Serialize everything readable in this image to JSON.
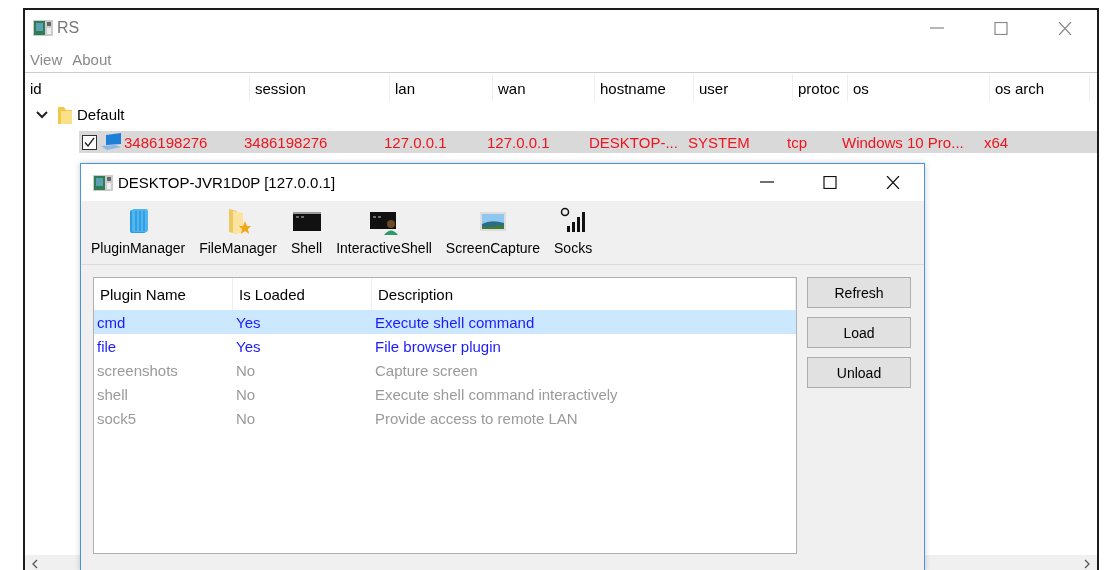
{
  "window": {
    "title": "RS"
  },
  "menu": [
    {
      "label": "View"
    },
    {
      "label": "About"
    }
  ],
  "table": {
    "columns": [
      "id",
      "session",
      "lan",
      "wan",
      "hostname",
      "user",
      "protoc",
      "os",
      "os arch"
    ],
    "groups": [
      {
        "name": "Default",
        "expanded": true,
        "rows": [
          {
            "checked": true,
            "selected": true,
            "cells": [
              "3486198276",
              "3486198276",
              "127.0.0.1",
              "127.0.0.1",
              "DESKTOP-...",
              "SYSTEM",
              "tcp",
              "Windows 10 Pro...",
              "x64"
            ]
          }
        ]
      }
    ]
  },
  "dialog": {
    "title": "DESKTOP-JVR1D0P [127.0.0.1]",
    "toolbar": [
      {
        "label": "PluginManager",
        "kind": "books"
      },
      {
        "label": "FileManager",
        "kind": "folder"
      },
      {
        "label": "Shell",
        "kind": "terminal"
      },
      {
        "label": "InteractiveShell",
        "kind": "userterminal"
      },
      {
        "label": "ScreenCapture",
        "kind": "image"
      },
      {
        "label": "Socks",
        "kind": "signal"
      }
    ],
    "plugins": {
      "columns": [
        "Plugin Name",
        "Is Loaded",
        "Description"
      ],
      "rows": [
        {
          "cells": [
            "cmd",
            "Yes",
            "Execute shell command"
          ],
          "loaded": true,
          "selected": true
        },
        {
          "cells": [
            "file",
            "Yes",
            "File browser plugin"
          ],
          "loaded": true,
          "selected": false
        },
        {
          "cells": [
            "screenshots",
            "No",
            "Capture screen"
          ],
          "loaded": false,
          "selected": false
        },
        {
          "cells": [
            "shell",
            "No",
            "Execute shell command interactively"
          ],
          "loaded": false,
          "selected": false
        },
        {
          "cells": [
            "sock5",
            "No",
            "Provide access to remote LAN"
          ],
          "loaded": false,
          "selected": false
        }
      ]
    },
    "buttons": [
      "Refresh",
      "Load",
      "Unload"
    ]
  }
}
